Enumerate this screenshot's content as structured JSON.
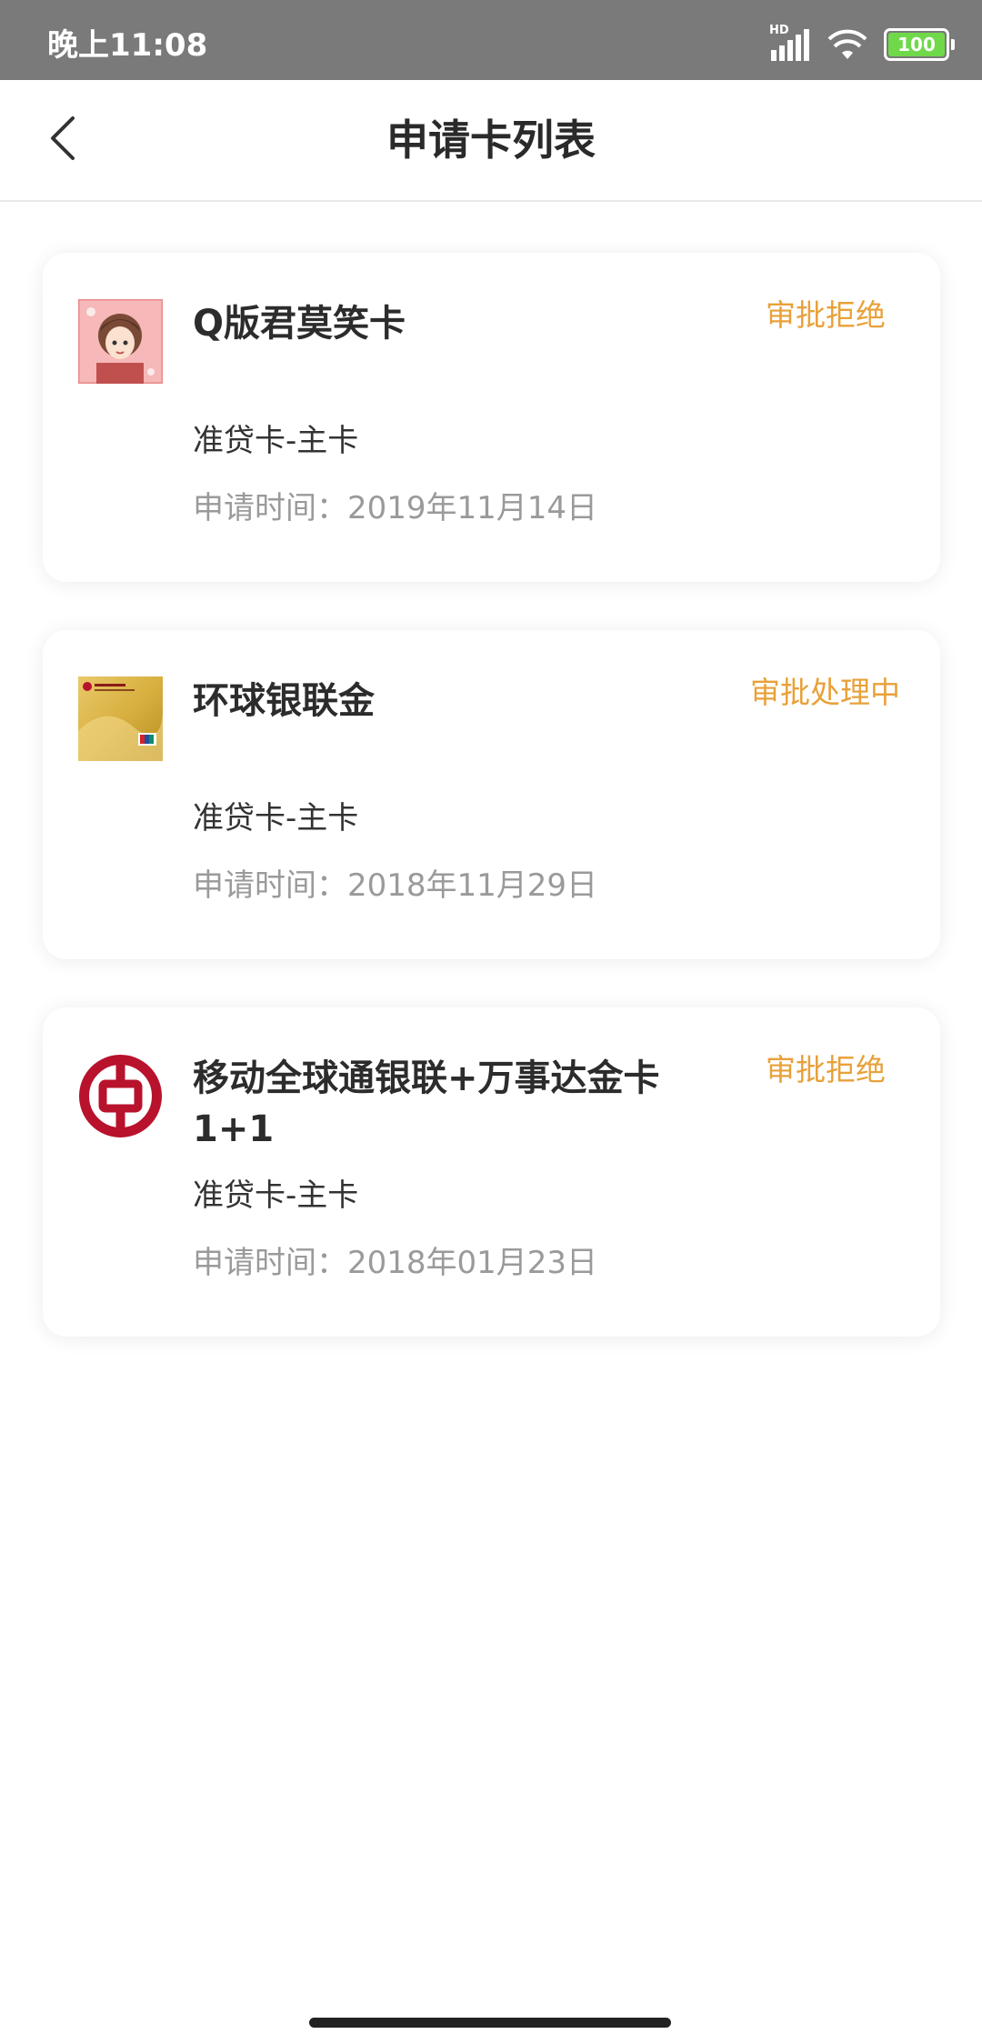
{
  "status_bar": {
    "time": "晚上11:08",
    "network_label": "HD",
    "battery_level": "100",
    "battery_color": "#6fd94a"
  },
  "nav": {
    "title": "申请卡列表",
    "back_icon": "chevron-left-icon"
  },
  "cards": [
    {
      "name": "Q版君莫笑卡",
      "status": "审批拒绝",
      "type": "准贷卡-主卡",
      "date": "申请时间：2019年11月14日",
      "thumbnail": "anime-card-thumbnail"
    },
    {
      "name": "环球银联金",
      "status": "审批处理中",
      "type": "准贷卡-主卡",
      "date": "申请时间：2018年11月29日",
      "thumbnail": "gold-card-thumbnail"
    },
    {
      "name": "移动全球通银联+万事达金卡1+1",
      "status": "审批拒绝",
      "type": "准贷卡-主卡",
      "date": "申请时间：2018年01月23日",
      "thumbnail": "bank-of-china-logo"
    }
  ],
  "colors": {
    "status_text": "#e8a13a",
    "status_bar_bg": "#7a7a7a",
    "logo_red": "#b8122c"
  }
}
